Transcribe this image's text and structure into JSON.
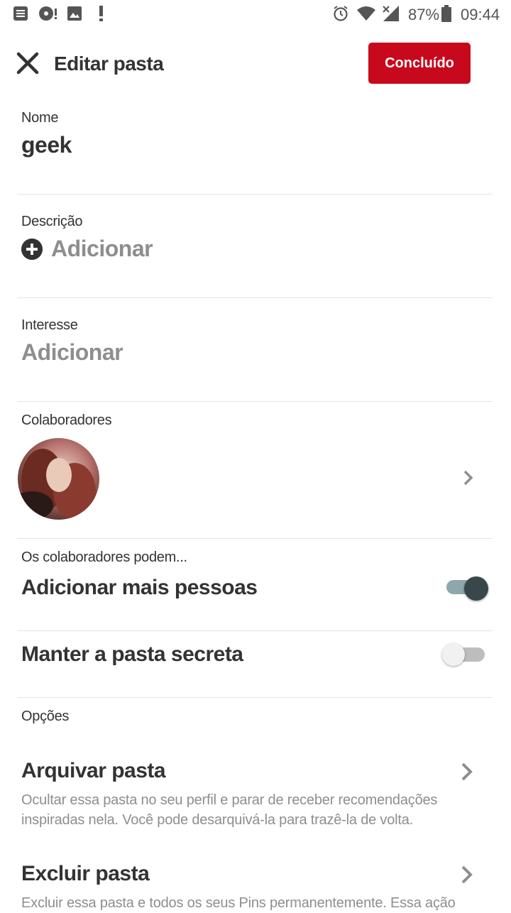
{
  "status_bar": {
    "battery": "87%",
    "time": "09:44"
  },
  "header": {
    "title": "Editar pasta",
    "done_label": "Concluído"
  },
  "fields": {
    "name_label": "Nome",
    "name_value": "geek",
    "description_label": "Descrição",
    "description_placeholder": "Adicionar",
    "interest_label": "Interesse",
    "interest_placeholder": "Adicionar",
    "collaborators_label": "Colaboradores"
  },
  "permissions": {
    "label": "Os colaboradores podem...",
    "add_people_label": "Adicionar mais pessoas",
    "add_people_on": true,
    "secret_label": "Manter a pasta secreta",
    "secret_on": false
  },
  "options": {
    "label": "Opções",
    "archive_title": "Arquivar pasta",
    "archive_desc": "Ocultar essa pasta no seu perfil e parar de receber recomendações inspiradas nela. Você pode desarquivá-la para trazê-la de volta.",
    "delete_title": "Excluir pasta",
    "delete_desc": "Excluir essa pasta e todos os seus Pins permanentemente. Essa ação"
  },
  "icons": [
    "notes-icon",
    "disc-alert-icon",
    "image-icon",
    "exclamation-icon",
    "alarm-icon",
    "wifi-icon",
    "signal-icon",
    "battery-icon",
    "close-icon",
    "plus-circle-icon",
    "chevron-right-icon"
  ],
  "colors": {
    "accent": "#c8081c",
    "toggle_on": "#37474a"
  }
}
